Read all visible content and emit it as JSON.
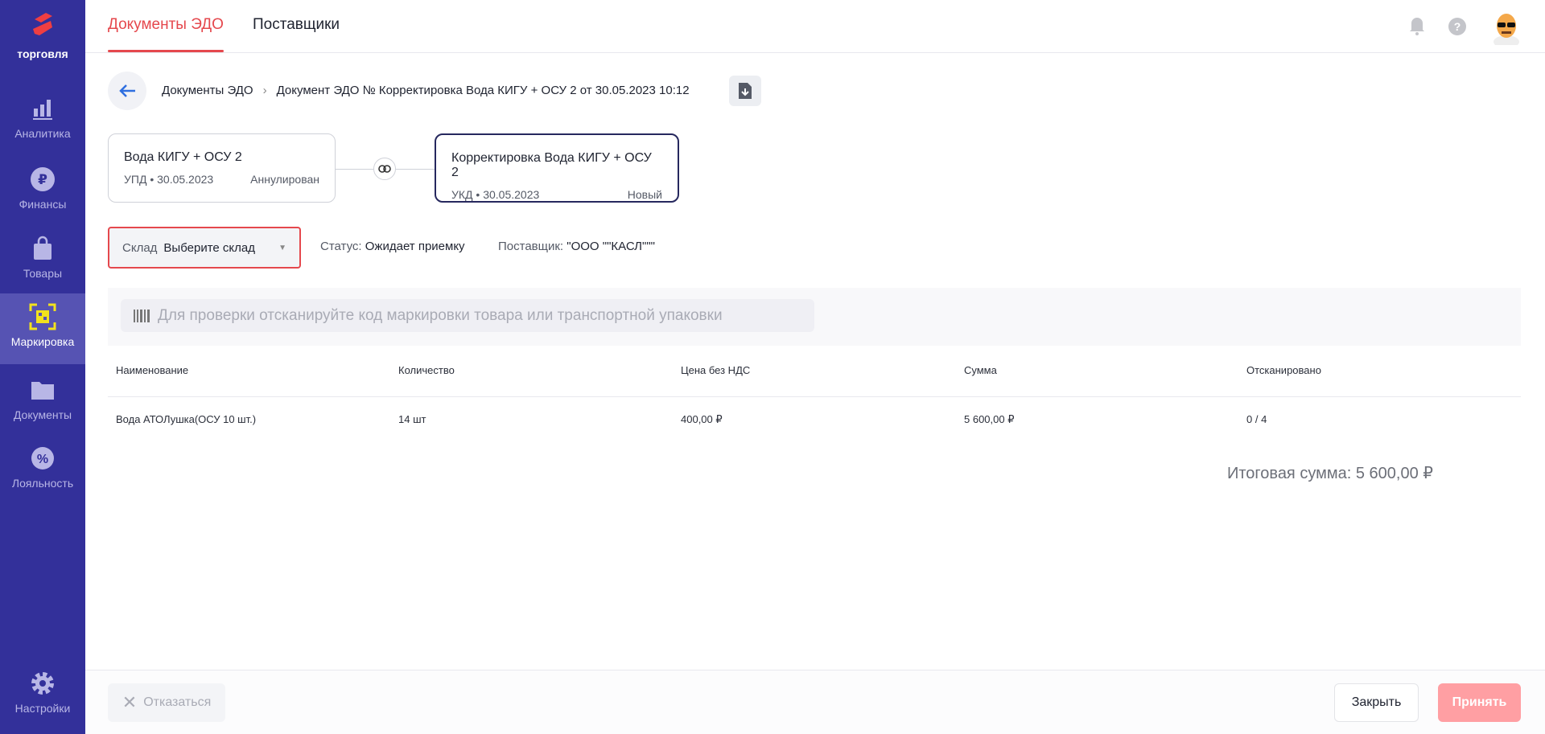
{
  "sidebar": {
    "logo": "торговля",
    "items": [
      {
        "label": "Аналитика"
      },
      {
        "label": "Финансы"
      },
      {
        "label": "Товары"
      },
      {
        "label": "Маркировка"
      },
      {
        "label": "Документы"
      },
      {
        "label": "Лояльность"
      },
      {
        "label": "Настройки"
      }
    ]
  },
  "header": {
    "tabs": [
      {
        "label": "Документы ЭДО"
      },
      {
        "label": "Поставщики"
      }
    ]
  },
  "breadcrumb": {
    "root": "Документы ЭДО",
    "current": "Документ ЭДО № Корректировка Вода КИГУ + ОСУ 2 от 30.05.2023 10:12"
  },
  "cards": [
    {
      "title": "Вода КИГУ + ОСУ 2",
      "meta": "УПД • 30.05.2023",
      "status": "Аннулирован"
    },
    {
      "title": "Корректировка Вода КИГУ + ОСУ 2",
      "meta": "УКД • 30.05.2023",
      "status": "Новый"
    }
  ],
  "filters": {
    "warehouse_label": "Склад",
    "warehouse_value": "Выберите склад",
    "status_label": "Статус:",
    "status_value": "Ожидает приемку",
    "supplier_label": "Поставщик:",
    "supplier_value": "\"ООО \"\"КАСЛ\"\"\""
  },
  "scan": {
    "placeholder": "Для проверки отсканируйте код маркировки товара или транспортной упаковки"
  },
  "table": {
    "columns": [
      "Наименование",
      "Количество",
      "Цена без НДС",
      "Сумма",
      "Отсканировано"
    ],
    "rows": [
      [
        "Вода АТОЛушка(ОСУ 10 шт.)",
        "14 шт",
        "400,00 ₽",
        "5 600,00 ₽",
        "0 / 4"
      ]
    ]
  },
  "total": "Итоговая сумма: 5 600,00 ₽",
  "footer": {
    "decline": "Отказаться",
    "close": "Закрыть",
    "accept": "Принять"
  },
  "colors": {
    "sidebar": "#33309a",
    "accent": "#e5484d",
    "accept_disabled": "#ff9fa3"
  }
}
